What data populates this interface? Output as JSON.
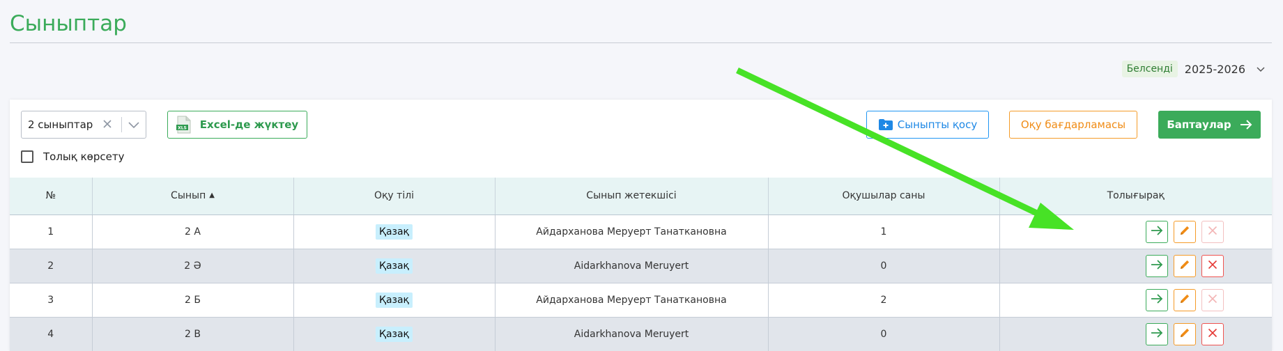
{
  "page": {
    "title": "Сыныптар"
  },
  "year_selector": {
    "status": "Белсенді",
    "year": "2025-2026"
  },
  "toolbar": {
    "class_select_value": "2 сыныптар",
    "excel_label": "Excel-де жүктеу",
    "add_class_label": "Сыныпты қосу",
    "program_label": "Оқу бағдарламасы",
    "settings_label": "Баптаулар",
    "full_show_label": "Толық көрсету"
  },
  "table": {
    "headers": [
      "№",
      "Сынып",
      "Оқу тілі",
      "Сынып жетекшісі",
      "Оқушылар саны",
      "Толығырақ"
    ],
    "rows": [
      {
        "num": "1",
        "class": "2 А",
        "lang": "Қазақ",
        "teacher": "Айдарханова Меруерт Танаткановна",
        "students": "1",
        "delete_enabled": false
      },
      {
        "num": "2",
        "class": "2 Ә",
        "lang": "Қазақ",
        "teacher": "Aidarkhanova Meruyert",
        "students": "0",
        "delete_enabled": true
      },
      {
        "num": "3",
        "class": "2 Б",
        "lang": "Қазақ",
        "teacher": "Айдарханова Меруерт Танаткановна",
        "students": "2",
        "delete_enabled": false
      },
      {
        "num": "4",
        "class": "2 В",
        "lang": "Қазақ",
        "teacher": "Aidarkhanova Meruyert",
        "students": "0",
        "delete_enabled": true
      }
    ]
  },
  "colors": {
    "accent_green": "#3bab5a",
    "blue": "#2196f3",
    "orange": "#f59b28",
    "red": "#ef5350",
    "annotation_arrow": "#47e226"
  },
  "icons": {
    "clear": "close-icon",
    "dropdown": "chevron-down-icon",
    "excel": "xls-file-icon",
    "add_class": "folder-plus-icon",
    "settings_arrow": "arrow-right-icon",
    "go": "arrow-right-icon",
    "edit": "pencil-icon",
    "delete": "close-icon",
    "sort": "sort-up-icon"
  }
}
